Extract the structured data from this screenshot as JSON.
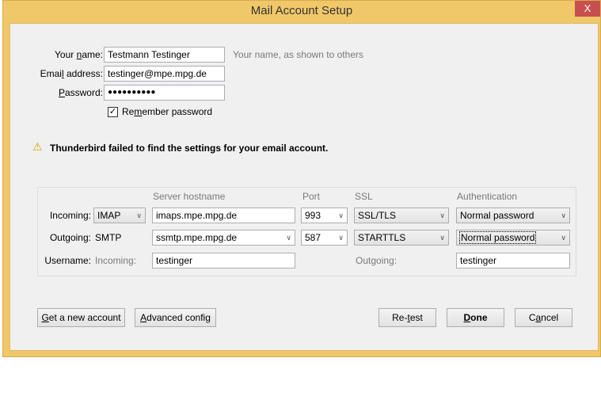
{
  "window": {
    "title": "Mail Account Setup",
    "close_label": "X"
  },
  "form": {
    "name": {
      "label": [
        "Your ",
        "n",
        "ame:"
      ],
      "value": "Testmann Testinger",
      "hint": "Your name, as shown to others"
    },
    "email": {
      "label": [
        "Emai",
        "l",
        " address:"
      ],
      "value": "testinger@mpe.mpg.de"
    },
    "password": {
      "label": [
        "",
        "P",
        "assword:"
      ],
      "value": "●●●●●●●●●●"
    },
    "remember": {
      "label": [
        "Re",
        "m",
        "ember password"
      ],
      "checked": true
    }
  },
  "warning": {
    "icon": "warning-triangle-icon",
    "text": "Thunderbird failed to find the settings for your email account."
  },
  "servers": {
    "headers": {
      "hostname": "Server hostname",
      "port": "Port",
      "ssl": "SSL",
      "auth": "Authentication"
    },
    "incoming": {
      "label": "Incoming:",
      "protocol": "IMAP",
      "hostname": "imaps.mpe.mpg.de",
      "port": "993",
      "ssl": "SSL/TLS",
      "auth": "Normal password"
    },
    "outgoing": {
      "label": "Outgoing:",
      "protocol": "SMTP",
      "hostname": "ssmtp.mpe.mpg.de",
      "port": "587",
      "ssl": "STARTTLS",
      "auth": "Normal password"
    },
    "username": {
      "label": "Username:",
      "incoming_label": "Incoming:",
      "incoming": "testinger",
      "outgoing_label": "Outgoing:",
      "outgoing": "testinger"
    }
  },
  "buttons": {
    "new_account": [
      "",
      "G",
      "et a new account"
    ],
    "advanced": [
      "",
      "A",
      "dvanced config"
    ],
    "retest": [
      "Re-",
      "t",
      "est"
    ],
    "done": [
      "",
      "D",
      "one"
    ],
    "cancel": [
      "C",
      "a",
      "ncel"
    ]
  },
  "colors": {
    "titlebar": "#f0c86a",
    "close": "#c7504f",
    "client": "#f0f0f0"
  }
}
